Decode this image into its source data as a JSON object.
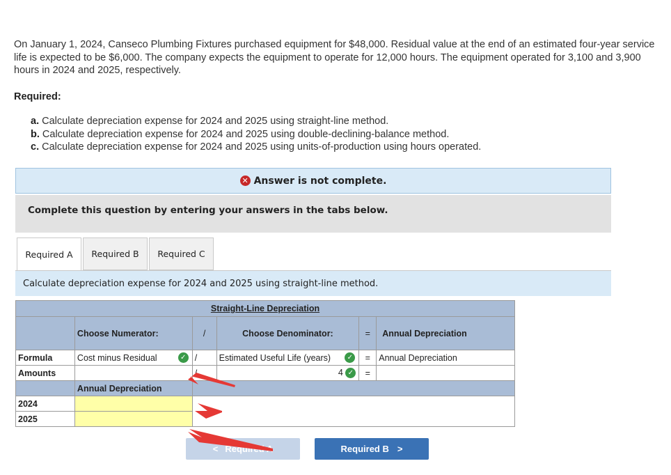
{
  "problem": {
    "text": "On January 1, 2024, Canseco Plumbing Fixtures purchased equipment for $48,000. Residual value at the end of an estimated four-year service life is expected to be $6,000. The company expects the equipment to operate for 12,000 hours. The equipment operated for 3,100 and 3,900 hours in 2024 and 2025, respectively.",
    "required_title": "Required:",
    "requirements": [
      {
        "letter": "a.",
        "text": "Calculate depreciation expense for 2024 and 2025 using straight-line method."
      },
      {
        "letter": "b.",
        "text": "Calculate depreciation expense for 2024 and 2025 using double-declining-balance method."
      },
      {
        "letter": "c.",
        "text": "Calculate depreciation expense for 2024 and 2025 using units-of-production using hours operated."
      }
    ]
  },
  "banner": {
    "icon": "error-x-icon",
    "text": "Answer is not complete.",
    "color": "#c62828"
  },
  "instruction": "Complete this question by entering your answers in the tabs below.",
  "tabs": [
    {
      "label": "Required A",
      "active": true
    },
    {
      "label": "Required B",
      "active": false
    },
    {
      "label": "Required C",
      "active": false
    }
  ],
  "task": "Calculate depreciation expense for 2024 and 2025 using straight-line method.",
  "table": {
    "title": "Straight-Line Depreciation",
    "headers": {
      "numerator": "Choose Numerator:",
      "divide": "/",
      "denominator": "Choose Denominator:",
      "equals": "=",
      "result": "Annual Depreciation"
    },
    "formula_row": {
      "label": "Formula",
      "numerator": "Cost minus Residual",
      "divide": "/",
      "denominator": "Estimated Useful Life (years)",
      "equals": "=",
      "result": "Annual Depreciation"
    },
    "amounts_row": {
      "label": "Amounts",
      "numerator": "",
      "divide": "/",
      "denominator": "4",
      "equals": "=",
      "result": ""
    },
    "sub_header": "Annual Depreciation",
    "years": [
      {
        "year": "2024",
        "value": ""
      },
      {
        "year": "2025",
        "value": ""
      }
    ]
  },
  "nav": {
    "prev": "Required A",
    "next": "Required B"
  },
  "colors": {
    "accent": "#3a72b5",
    "header_blue": "#a9bcd6",
    "input_yellow": "#ffffa8",
    "check_green": "#3a9a48",
    "annotation_red": "#e53935"
  }
}
